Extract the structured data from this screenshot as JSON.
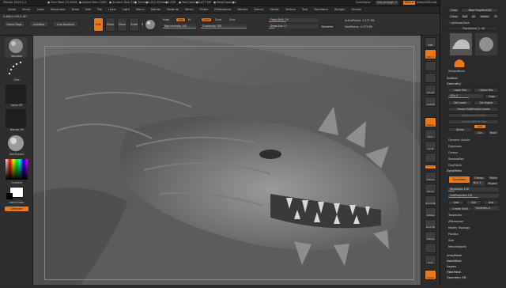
{
  "titlebar": {
    "app": "ZBrush 2019.1.2",
    "items": [
      "● Free Mem 23.94GB",
      "● Active Mem 1089",
      "● Scratch Disk 320",
      "● Timer●0.012 ATime●0.039",
      "● PolyCount●0.477 MP",
      "● MeshCount●1"
    ],
    "quicksave": "QuickSave",
    "seethrough": "See-through  0",
    "menus_btn": "Menus",
    "default_script": "DefaultZScript"
  },
  "menubar": [
    "Alpha",
    "Brush",
    "Color",
    "Document",
    "Draw",
    "Edit",
    "File",
    "Layer",
    "Light",
    "Macro",
    "Marker",
    "Material",
    "Movie",
    "Picker",
    "Preferences",
    "Render",
    "Stencil",
    "Stroke",
    "Texture",
    "Tool",
    "Transform",
    "Zplugin",
    "Zscript"
  ],
  "menubar_right": "",
  "toolshelf": {
    "coords": "0.466,0.559,0.167",
    "home": "Home Page",
    "lightbox": "LightBox",
    "liveboolean": "Live Boolean",
    "edit": "Edit",
    "draw": "Draw",
    "move": "Move",
    "scale": "Scale",
    "rotate": "Rotate",
    "mrgb": "Mrgb",
    "rgb": "Rgb",
    "m": "M",
    "zadd": "Zadd",
    "zsub": "Zsub",
    "zcut": "Zcut",
    "rgb_intensity": "Rgb Intensity 100",
    "z_intensity": "Z Intensity 100",
    "focal_shift": "Focal Shift -30",
    "draw_size": "Draw Size 17",
    "dynamic": "Dynamic",
    "active_points": "ActivePoints: 3.477 Mil",
    "total_points": "TotalPoints: 4.373 Mil"
  },
  "leftshelf": {
    "brush": "Standard",
    "stroke": "Dots",
    "alpha": "Alpha Off",
    "texture": "Texture Off",
    "material": "SkinShade4",
    "gradient": "Gradient",
    "switch": "SwitchColor",
    "alternate": "Alternate"
  },
  "rightshelf": [
    "BPR",
    "SPix 3",
    "",
    "Actual",
    "AAHalf",
    "Dynamic",
    "Persp",
    "Floor",
    "Local",
    "",
    "",
    "Frame",
    "Move",
    "Zoom3D",
    "Rotate",
    "Line Fill",
    "Transp",
    "",
    "Solo",
    "",
    "Xpose"
  ],
  "tray": {
    "close": "Close",
    "make_polymesh": "Make PolyMesh3D",
    "clone": "Clone",
    "goz": "GoZ",
    "all": "All",
    "visible": "Visible",
    "r": "R",
    "lightbox_tools": "Lightbox▸Tools",
    "polysphere": "PolySphere_2. 48",
    "simplebrush": "SimpleBrush",
    "subtool": "Subtool",
    "geometry": "Geometry",
    "lower_res": "Lower Res",
    "higher_res": "Higher Res",
    "sdiv": "SDiv 5",
    "cage": "Cage",
    "del_lower": "Del Lower",
    "del_higher": "Del Higher",
    "freeze": "Freeze SubDivision Levels",
    "reconstruct": "Reconstruct Subdiv",
    "convert_bpr": "Convert BPR To Geo",
    "divide": "Divide",
    "smt": "Smt",
    "suv": "Suv",
    "rsuv": "ReUV",
    "dynamic_subdiv": "Dynamic Subdiv",
    "edgeloop": "EdgeLoop",
    "crease": "Crease",
    "shadowbox": "ShadowBox",
    "claypolish": "ClayPolish",
    "dynamesh_hdr": "DynaMesh",
    "dynamesh": "DynaMesh",
    "groups": "Groups",
    "polish": "Polish",
    "blur": "Blur 2",
    "project": "Project",
    "resolution": "Resolution 128",
    "subprojection": "SubProjection 0.6",
    "add": "Add",
    "sub": "Sub",
    "and": "And",
    "create_shell": "Create Shell",
    "thickness": "Thickness 4",
    "tessimate": "Tessimate",
    "zremesher": "ZRemesher",
    "modify_topology": "Modify Topology",
    "position": "Position",
    "size": "Size",
    "meshintegrity": "MeshIntegrity",
    "arraymesh": "ArrayMesh",
    "nanomesh": "NanoMesh",
    "layers": "Layers",
    "fibermesh": "FiberMesh",
    "geometry_hd": "Geometry HD"
  }
}
